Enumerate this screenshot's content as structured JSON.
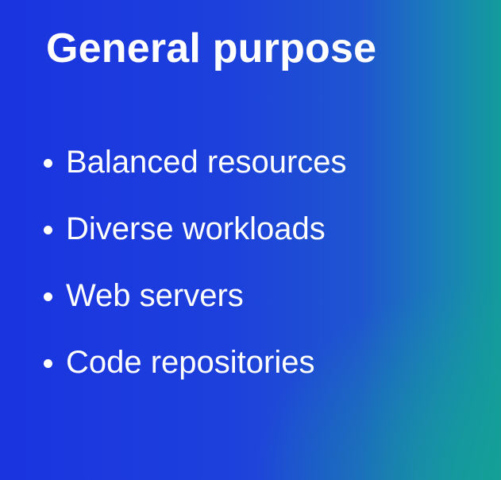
{
  "slide": {
    "title": "General purpose",
    "bullets": [
      "Balanced resources",
      "Diverse workloads",
      "Web servers",
      "Code repositories"
    ]
  },
  "colors": {
    "background_primary": "#1a34e0",
    "background_accent": "#139c9c",
    "text": "#ffffff"
  },
  "icons": {
    "bullet": "bullet-dot-icon"
  }
}
